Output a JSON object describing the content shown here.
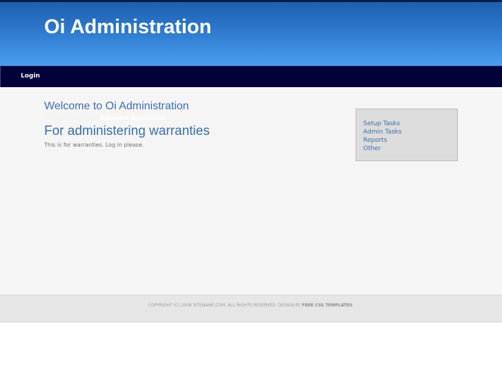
{
  "header": {
    "site_title": "Oi Administration"
  },
  "menu": {
    "items": [
      {
        "label": "Login"
      }
    ]
  },
  "main": {
    "welcome_title": "Welcome to Oi Administration",
    "byline_prefix": "A Web template for",
    "byline_emphasis": "Database Application",
    "entry_title": "For administering warranties",
    "entry_text": "This is for warranties. Log in please."
  },
  "sidebar": {
    "items": [
      {
        "label": "Setup Tasks"
      },
      {
        "label": "Admin Tasks"
      },
      {
        "label": "Reports"
      },
      {
        "label": "Other"
      }
    ]
  },
  "footer": {
    "copyright": "COPYRIGHT (C) 2008 SITENAME.COM. ALL RIGHTS RESERVED. DESIGN BY",
    "design_link": "FREE CSS TEMPLATES",
    "end": "."
  },
  "colors": {
    "header_gradient_top": "#1e5fae",
    "header_gradient_bottom": "#4b9df0",
    "menu_bar": "#00003a",
    "link": "#3b6ea8",
    "content_bg": "#f5f5f5",
    "sidebar_bg": "#dcdcdc",
    "footer_bg": "#e6e6e6"
  }
}
